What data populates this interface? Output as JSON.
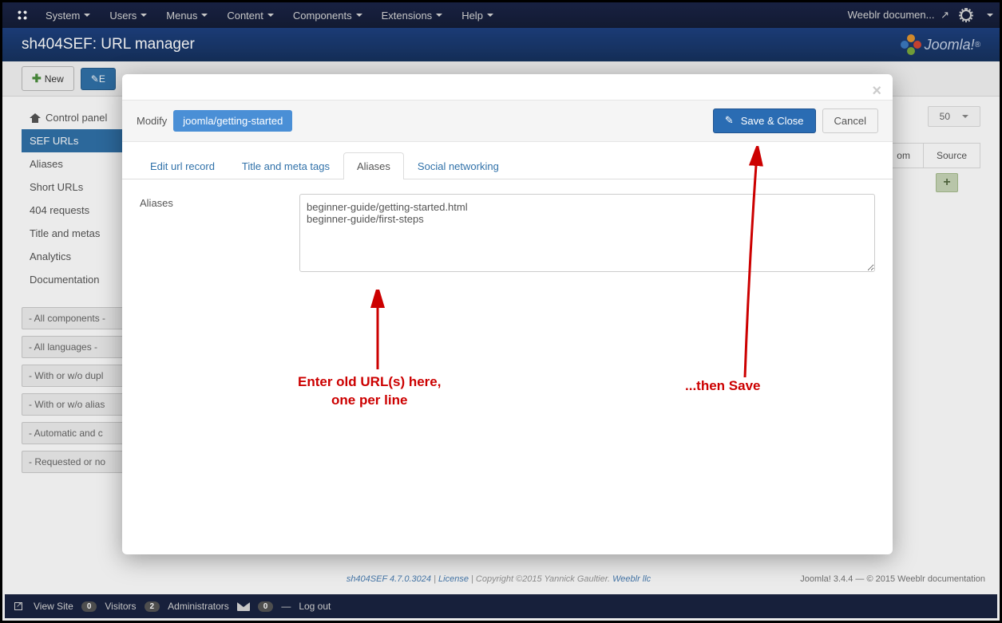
{
  "top": {
    "menus": [
      "System",
      "Users",
      "Menus",
      "Content",
      "Components",
      "Extensions",
      "Help"
    ],
    "site": "Weeblr documen..."
  },
  "header": {
    "title": "sh404SEF: URL manager",
    "brand": "Joomla!"
  },
  "toolbar": {
    "new": "New",
    "edit": "E"
  },
  "sidebar": {
    "items": [
      "Control panel",
      "SEF URLs",
      "Aliases",
      "Short URLs",
      "404 requests",
      "Title and metas",
      "Analytics",
      "Documentation"
    ],
    "filters": [
      "- All components -",
      "- All languages -",
      "- With or w/o dupl",
      "- With or w/o alias",
      "- Automatic and c",
      "- Requested or no"
    ]
  },
  "pagesize": "50",
  "cols": {
    "c1": "om",
    "c2": "Source"
  },
  "addbtn": "+",
  "footer": {
    "left": "sh404SEF 4.7.0.3024",
    "lic": "License",
    "copy": "Copyright ©2015 Yannick Gaultier.",
    "wb": "Weeblr llc",
    "ver": "Joomla! 3.4.4 — © 2015 Weeblr documentation"
  },
  "status": {
    "view": "View Site",
    "v": "0",
    "vl": "Visitors",
    "a": "2",
    "al": "Administrators",
    "m": "0",
    "lo": "Log out"
  },
  "modal": {
    "modify": "Modify",
    "url": "joomla/getting-started",
    "save": "Save & Close",
    "cancel": "Cancel",
    "tabs": [
      "Edit url record",
      "Title and meta tags",
      "Aliases",
      "Social networking"
    ],
    "label": "Aliases",
    "value": "beginner-guide/getting-started.html\nbeginner-guide/first-steps"
  },
  "ann": {
    "a1": "Enter old URL(s) here,\none per line",
    "a2": "...then Save"
  }
}
